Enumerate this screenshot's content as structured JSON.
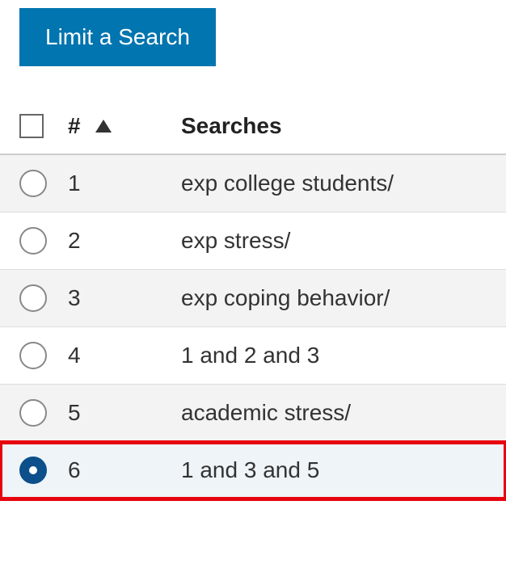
{
  "button": {
    "limit_label": "Limit a Search"
  },
  "columns": {
    "num_header": "#",
    "searches_header": "Searches"
  },
  "rows": [
    {
      "num": "1",
      "search": "exp college students/",
      "selected": false
    },
    {
      "num": "2",
      "search": "exp stress/",
      "selected": false
    },
    {
      "num": "3",
      "search": "exp coping behavior/",
      "selected": false
    },
    {
      "num": "4",
      "search": "1 and 2 and 3",
      "selected": false
    },
    {
      "num": "5",
      "search": "academic stress/",
      "selected": false
    },
    {
      "num": "6",
      "search": "1 and 3 and 5",
      "selected": true,
      "highlighted": true
    }
  ]
}
